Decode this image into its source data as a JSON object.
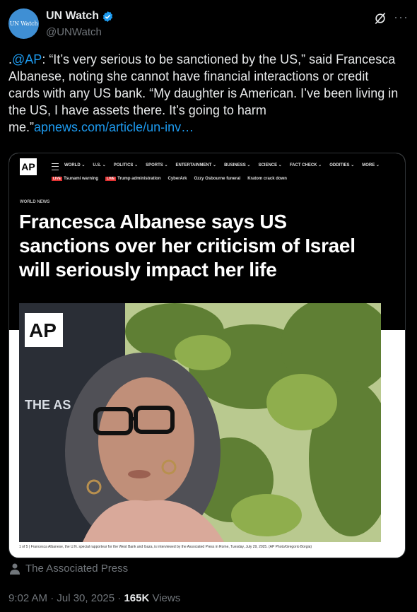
{
  "account": {
    "display_name": "UN Watch",
    "handle": "@UNWatch",
    "avatar_text": "UN Watch"
  },
  "tweet": {
    "prefix": ".",
    "mention": "@AP",
    "body": ": “It’s very serious to be sanctioned by the US,” said Francesca Albanese, noting she cannot have financial interactions or credit cards with any US bank. “My daughter is American. I’ve been living in the US, I have assets there. It’s going to harm me.”",
    "link": "apnews.com/article/un-inv…"
  },
  "card": {
    "logo": "AP",
    "nav": [
      "WORLD ⌄",
      "U.S. ⌄",
      "POLITICS ⌄",
      "SPORTS ⌄",
      "ENTERTAINMENT ⌄",
      "BUSINESS ⌄",
      "SCIENCE ⌄",
      "FACT CHECK ⌄",
      "ODDITIES ⌄",
      "MORE ⌄"
    ],
    "trending": [
      {
        "live": "LIVE",
        "label": "Tsunami warning"
      },
      {
        "live": "LIVE",
        "label": "Trump administration"
      },
      {
        "live": "",
        "label": "CyberArk"
      },
      {
        "live": "",
        "label": "Ozzy Osbourne funeral"
      },
      {
        "live": "",
        "label": "Kratom crack down"
      }
    ],
    "kicker": "WORLD NEWS",
    "headline": "Francesca Albanese says US sanctions over her criticism of Israel will seriously impact her life",
    "photo_sign_logo": "AP",
    "photo_sign_text": "THE AS",
    "caption": "1 of 5 | Francesca Albanese, the U.N. special rapporteur for the West Bank and Gaza, is interviewed by the Associated Press in Rome, Tuesday, July 29, 2025. (AP Photo/Gregorio Borgia)"
  },
  "source": {
    "label": "The Associated Press",
    "icon": "person-icon"
  },
  "meta": {
    "time": "9:02 AM · Jul 30, 2025 · ",
    "views_count": "165K",
    "views_label": " Views"
  }
}
